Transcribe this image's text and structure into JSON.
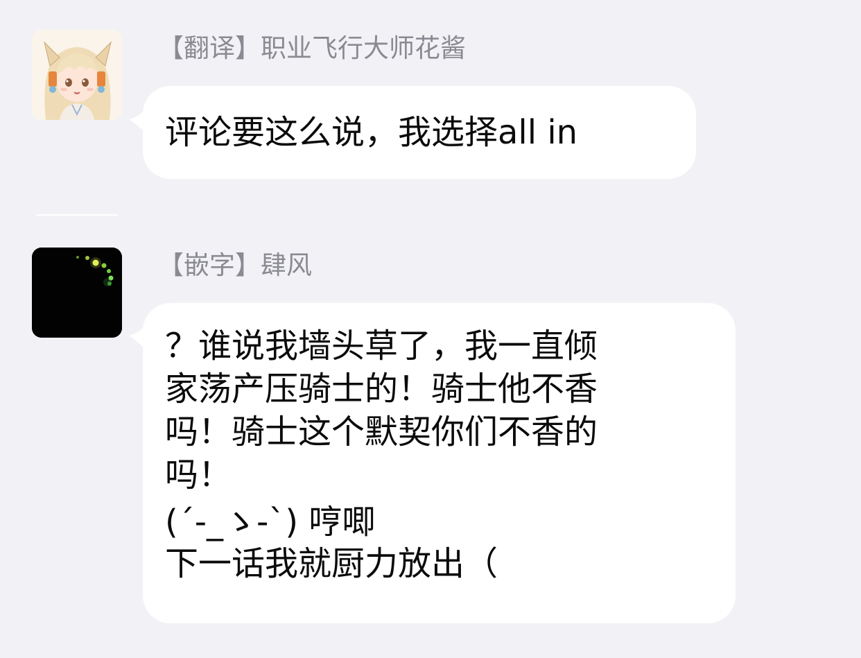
{
  "messages": [
    {
      "sender": "【翻译】职业飞行大师花酱",
      "avatar": "anime-fox-girl-avatar",
      "lines": [
        "评论要这么说，我选择all in"
      ]
    },
    {
      "sender": "【嵌字】肆风",
      "avatar": "dark-fireflies-avatar",
      "lines": [
        "？谁说我墙头草了，我一直倾",
        "家荡产压骑士的！骑士他不香",
        "吗！骑士这个默契你们不香的",
        "吗！",
        "(´-_ゝ-`) 哼唧",
        "下一话我就厨力放出（"
      ]
    }
  ],
  "colors": {
    "background": "#f2f2f6",
    "bubble": "#ffffff",
    "sender_text": "#8a8a92",
    "message_text": "#0b0b0b"
  }
}
